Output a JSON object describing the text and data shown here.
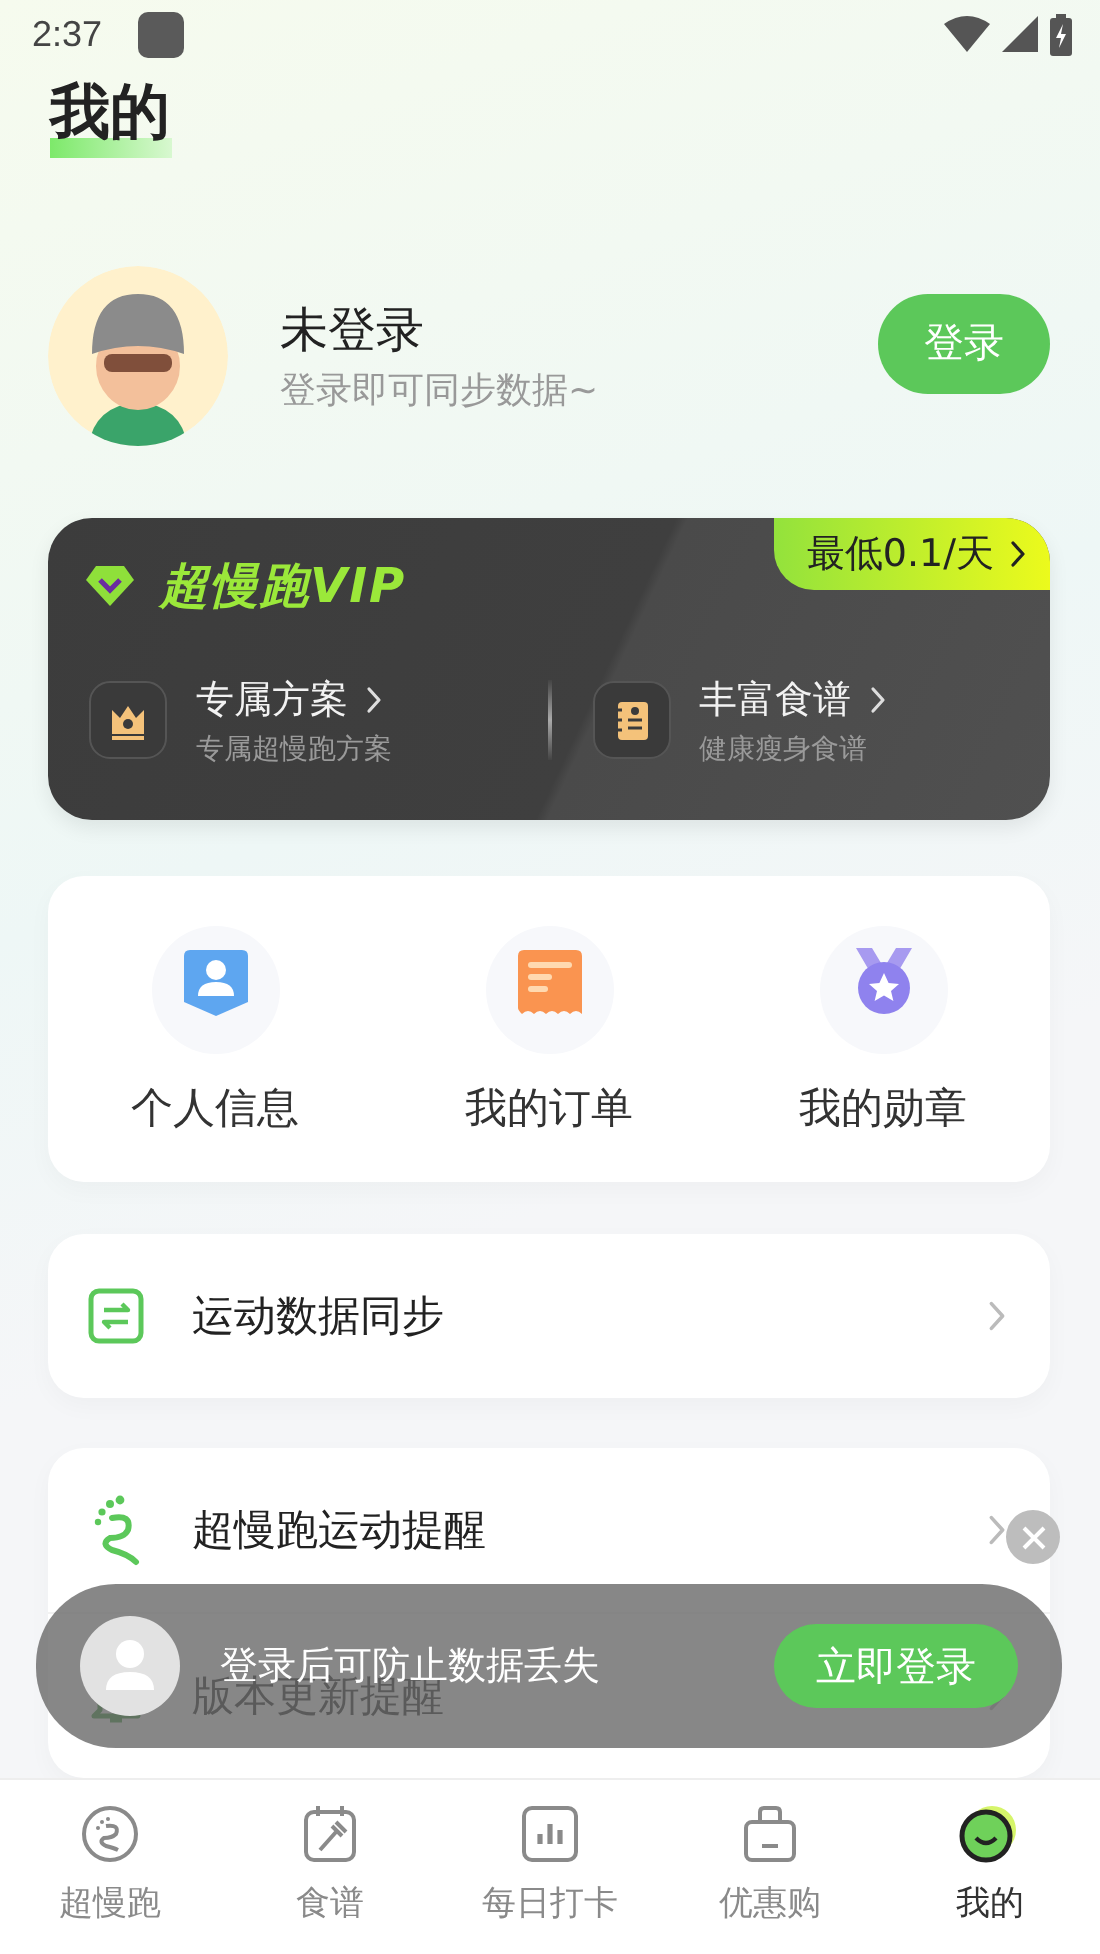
{
  "status_bar": {
    "time": "2:37"
  },
  "page_title": "我的",
  "profile": {
    "name": "未登录",
    "hint": "登录即可同步数据~",
    "login_button": "登录"
  },
  "vip_card": {
    "title": "超慢跑VIP",
    "price_badge": "最低0.1/天",
    "features": [
      {
        "kind": "crown",
        "title": "专属方案",
        "subtitle": "专属超慢跑方案"
      },
      {
        "kind": "recipe",
        "title": "丰富食谱",
        "subtitle": "健康瘦身食谱"
      }
    ]
  },
  "shortcuts": [
    {
      "kind": "profile",
      "label": "个人信息"
    },
    {
      "kind": "order",
      "label": "我的订单"
    },
    {
      "kind": "medal",
      "label": "我的勋章"
    }
  ],
  "settings_groups": [
    [
      {
        "kind": "sync",
        "label": "运动数据同步"
      }
    ],
    [
      {
        "kind": "footprint",
        "label": "超慢跑运动提醒"
      },
      {
        "kind": "bell",
        "label": "版本更新提醒"
      }
    ]
  ],
  "login_toast": {
    "message": "登录后可防止数据丢失",
    "button": "立即登录"
  },
  "bottom_nav": [
    {
      "kind": "run",
      "label": "超慢跑",
      "selected": false
    },
    {
      "kind": "recipe",
      "label": "食谱",
      "selected": false
    },
    {
      "kind": "checkin",
      "label": "每日打卡",
      "selected": false
    },
    {
      "kind": "shop",
      "label": "优惠购",
      "selected": false
    },
    {
      "kind": "mine",
      "label": "我的",
      "selected": true
    }
  ]
}
